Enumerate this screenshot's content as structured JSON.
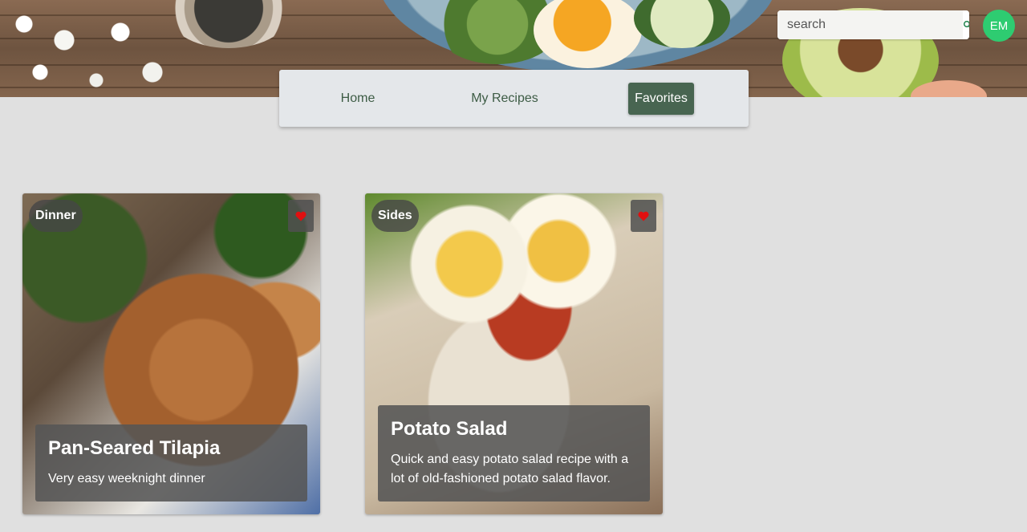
{
  "search": {
    "placeholder": "search",
    "icon": "search-icon"
  },
  "user": {
    "initials": "EM",
    "avatar_color": "#2ecc71"
  },
  "nav": {
    "tabs": [
      {
        "label": "Home",
        "active": false
      },
      {
        "label": "My Recipes",
        "active": false
      },
      {
        "label": "Favorites",
        "active": true
      }
    ],
    "active_color": "#486551"
  },
  "recipes": [
    {
      "category": "Dinner",
      "title": "Pan-Seared Tilapia",
      "description": "Very easy weeknight dinner",
      "favorited": true
    },
    {
      "category": "Sides",
      "title": "Potato Salad",
      "description": "Quick and easy potato salad recipe with a lot of old-fashioned potato salad flavor.",
      "favorited": true
    }
  ],
  "colors": {
    "heart": "#e01010",
    "background": "#e0e0e0"
  }
}
